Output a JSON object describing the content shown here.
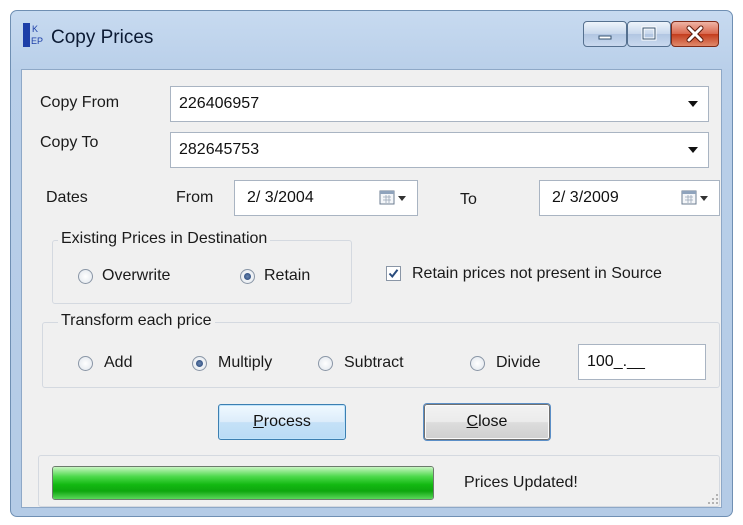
{
  "window": {
    "title": "Copy Prices",
    "icon_name": "app-kep-icon",
    "controls": [
      "minimize-icon",
      "maximize-icon",
      "close-icon"
    ]
  },
  "copy_from": {
    "label": "Copy From",
    "value": "226406957"
  },
  "copy_to": {
    "label": "Copy To",
    "value": "282645753"
  },
  "dates": {
    "label": "Dates",
    "from_label": "From",
    "from_value": "2/ 3/2004",
    "to_label": "To",
    "to_value": "2/ 3/2009"
  },
  "existing": {
    "title": "Existing Prices in Destination",
    "overwrite_label": "Overwrite",
    "retain_label": "Retain",
    "selected": "Retain"
  },
  "retain_missing": {
    "label": "Retain prices not present in Source",
    "checked": true
  },
  "transform": {
    "title": "Transform each price",
    "add_label": "Add",
    "multiply_label": "Multiply",
    "subtract_label": "Subtract",
    "divide_label": "Divide",
    "selected": "Multiply",
    "value": "100_.__"
  },
  "buttons": {
    "process_label": "Process",
    "process_mnemonic": "P",
    "process_rest": "rocess",
    "close_label": "Close",
    "close_mnemonic": "C",
    "close_rest": "lose"
  },
  "status": {
    "progress_percent": 100,
    "message": "Prices Updated!"
  },
  "colors": {
    "title_bar": "#c2d6ee",
    "progress_green": "#13b912",
    "close_button": "#c43d1d"
  }
}
